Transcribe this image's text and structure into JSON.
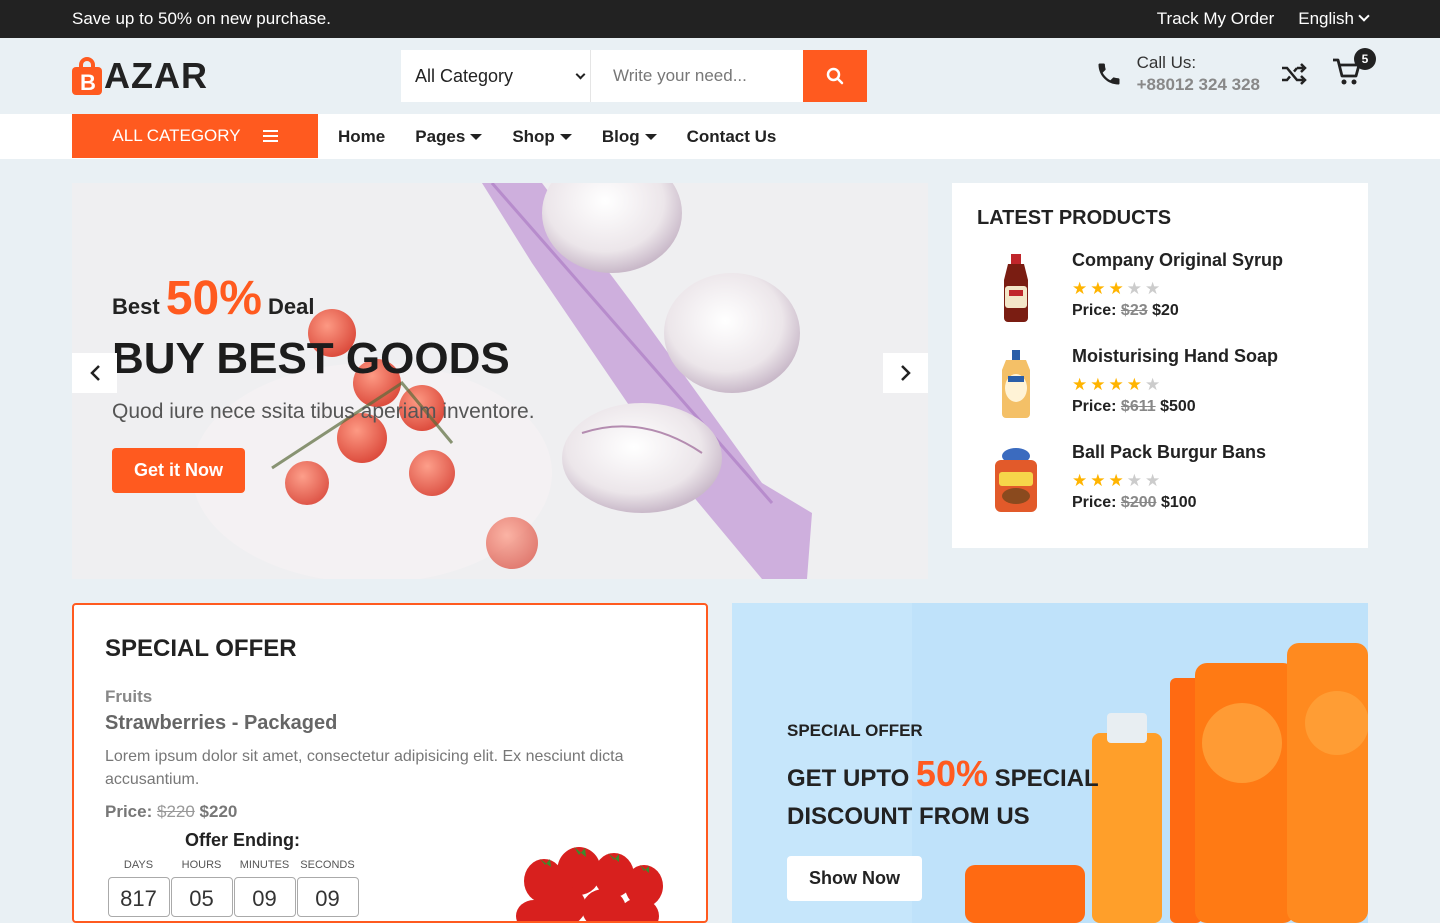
{
  "topbar": {
    "promo": "Save up to 50% on new purchase.",
    "track_order": "Track My Order",
    "language": "English"
  },
  "header": {
    "logo_text": "AZAR",
    "logo_letter": "B",
    "search": {
      "category": "All Category",
      "placeholder": "Write your need..."
    },
    "call": {
      "label": "Call Us:",
      "number": "+88012 324 328"
    },
    "cart_count": "5"
  },
  "nav": {
    "all_category": "ALL CATEGORY",
    "links": [
      {
        "label": "Home",
        "dropdown": false
      },
      {
        "label": "Pages",
        "dropdown": true
      },
      {
        "label": "Shop",
        "dropdown": true
      },
      {
        "label": "Blog",
        "dropdown": true
      },
      {
        "label": "Contact Us",
        "dropdown": false
      }
    ]
  },
  "hero": {
    "deal_prefix": "Best",
    "deal_percent": "50%",
    "deal_suffix": "Deal",
    "title": "BUY BEST GOODS",
    "subtitle": "Quod iure nece ssita tibus aperiam inventore.",
    "cta": "Get it Now"
  },
  "latest": {
    "title": "LATEST PRODUCTS",
    "products": [
      {
        "name": "Company Original Syrup",
        "rating": 3,
        "price_label": "Price:",
        "old_price": "$23",
        "price": "$20"
      },
      {
        "name": "Moisturising Hand Soap",
        "rating": 4,
        "price_label": "Price:",
        "old_price": "$611",
        "price": "$500"
      },
      {
        "name": "Ball Pack Burgur Bans",
        "rating": 3,
        "price_label": "Price:",
        "old_price": "$200",
        "price": "$100"
      }
    ]
  },
  "special": {
    "title": "SPECIAL OFFER",
    "category": "Fruits",
    "product": "Strawberries - Packaged",
    "description": "Lorem ipsum dolor sit amet, consectetur adipisicing elit. Ex nesciunt dicta accusantium.",
    "price_label": "Price:",
    "old_price": "$220",
    "price": "$220",
    "ending_label": "Offer Ending:",
    "countdown": [
      {
        "label": "DAYS",
        "value": "817"
      },
      {
        "label": "HOURS",
        "value": "05"
      },
      {
        "label": "MINUTES",
        "value": "09"
      },
      {
        "label": "SECONDS",
        "value": "09"
      }
    ]
  },
  "banner2": {
    "label": "SPECIAL OFFER",
    "line1_prefix": "GET UPTO",
    "percent": "50%",
    "line1_suffix": "SPECIAL",
    "line2": "DISCOUNT FROM US",
    "cta": "Show Now"
  },
  "colors": {
    "accent": "#ff5a1f",
    "topbar": "#222222",
    "page_bg": "#e9f0f4"
  }
}
